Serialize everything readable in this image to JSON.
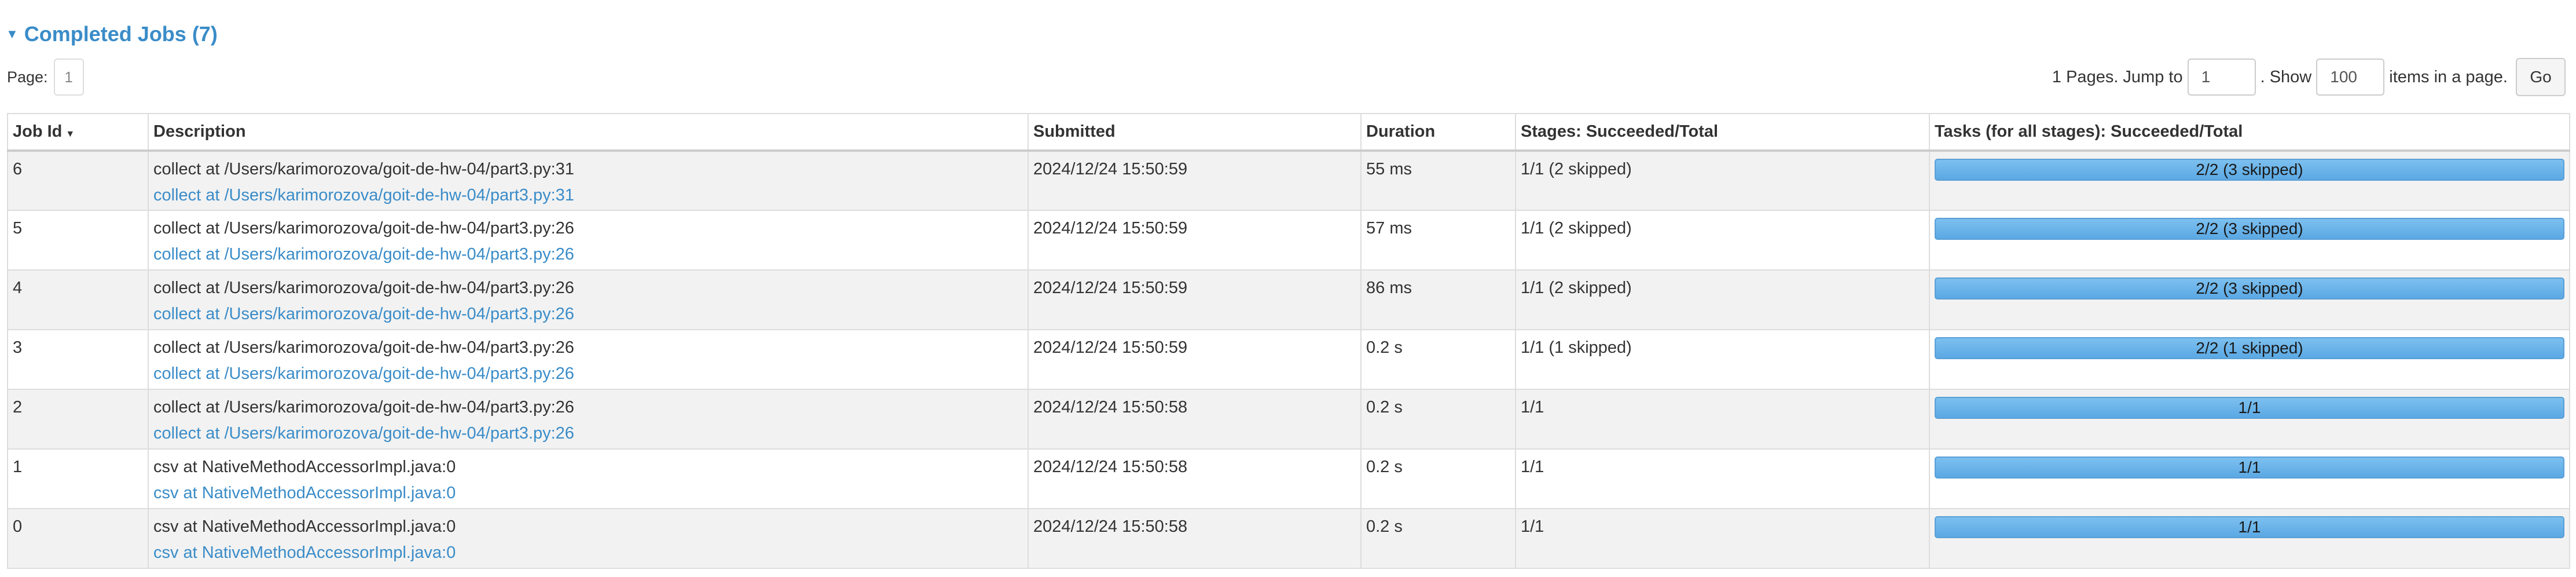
{
  "section": {
    "title": "Completed Jobs (7)"
  },
  "pager": {
    "page_label": "Page:",
    "current_page": "1",
    "pages_text": "1 Pages. Jump to",
    "jump_value": "1",
    "show_text": ". Show",
    "show_value": "100",
    "items_text": "items in a page.",
    "go_label": "Go"
  },
  "columns": {
    "job_id": "Job Id",
    "description": "Description",
    "submitted": "Submitted",
    "duration": "Duration",
    "stages": "Stages: Succeeded/Total",
    "tasks": "Tasks (for all stages): Succeeded/Total"
  },
  "rows": [
    {
      "job_id": "6",
      "desc": "collect at /Users/karimorozova/goit-de-hw-04/part3.py:31",
      "desc_link": "collect at /Users/karimorozova/goit-de-hw-04/part3.py:31",
      "submitted": "2024/12/24 15:50:59",
      "duration": "55 ms",
      "stages": "1/1 (2 skipped)",
      "tasks": "2/2 (3 skipped)",
      "tasks_progress": 1.0
    },
    {
      "job_id": "5",
      "desc": "collect at /Users/karimorozova/goit-de-hw-04/part3.py:26",
      "desc_link": "collect at /Users/karimorozova/goit-de-hw-04/part3.py:26",
      "submitted": "2024/12/24 15:50:59",
      "duration": "57 ms",
      "stages": "1/1 (2 skipped)",
      "tasks": "2/2 (3 skipped)",
      "tasks_progress": 1.0
    },
    {
      "job_id": "4",
      "desc": "collect at /Users/karimorozova/goit-de-hw-04/part3.py:26",
      "desc_link": "collect at /Users/karimorozova/goit-de-hw-04/part3.py:26",
      "submitted": "2024/12/24 15:50:59",
      "duration": "86 ms",
      "stages": "1/1 (2 skipped)",
      "tasks": "2/2 (3 skipped)",
      "tasks_progress": 1.0
    },
    {
      "job_id": "3",
      "desc": "collect at /Users/karimorozova/goit-de-hw-04/part3.py:26",
      "desc_link": "collect at /Users/karimorozova/goit-de-hw-04/part3.py:26",
      "submitted": "2024/12/24 15:50:59",
      "duration": "0.2 s",
      "stages": "1/1 (1 skipped)",
      "tasks": "2/2 (1 skipped)",
      "tasks_progress": 1.0
    },
    {
      "job_id": "2",
      "desc": "collect at /Users/karimorozova/goit-de-hw-04/part3.py:26",
      "desc_link": "collect at /Users/karimorozova/goit-de-hw-04/part3.py:26",
      "submitted": "2024/12/24 15:50:58",
      "duration": "0.2 s",
      "stages": "1/1",
      "tasks": "1/1",
      "tasks_progress": 1.0
    },
    {
      "job_id": "1",
      "desc": "csv at NativeMethodAccessorImpl.java:0",
      "desc_link": "csv at NativeMethodAccessorImpl.java:0",
      "submitted": "2024/12/24 15:50:58",
      "duration": "0.2 s",
      "stages": "1/1",
      "tasks": "1/1",
      "tasks_progress": 1.0
    },
    {
      "job_id": "0",
      "desc": "csv at NativeMethodAccessorImpl.java:0",
      "desc_link": "csv at NativeMethodAccessorImpl.java:0",
      "submitted": "2024/12/24 15:50:58",
      "duration": "0.2 s",
      "stages": "1/1",
      "tasks": "1/1",
      "tasks_progress": 1.0
    }
  ],
  "colors": {
    "accent": "#3a8cc8",
    "bar": "#6cb4ea",
    "row_alt": "#f2f2f2"
  }
}
